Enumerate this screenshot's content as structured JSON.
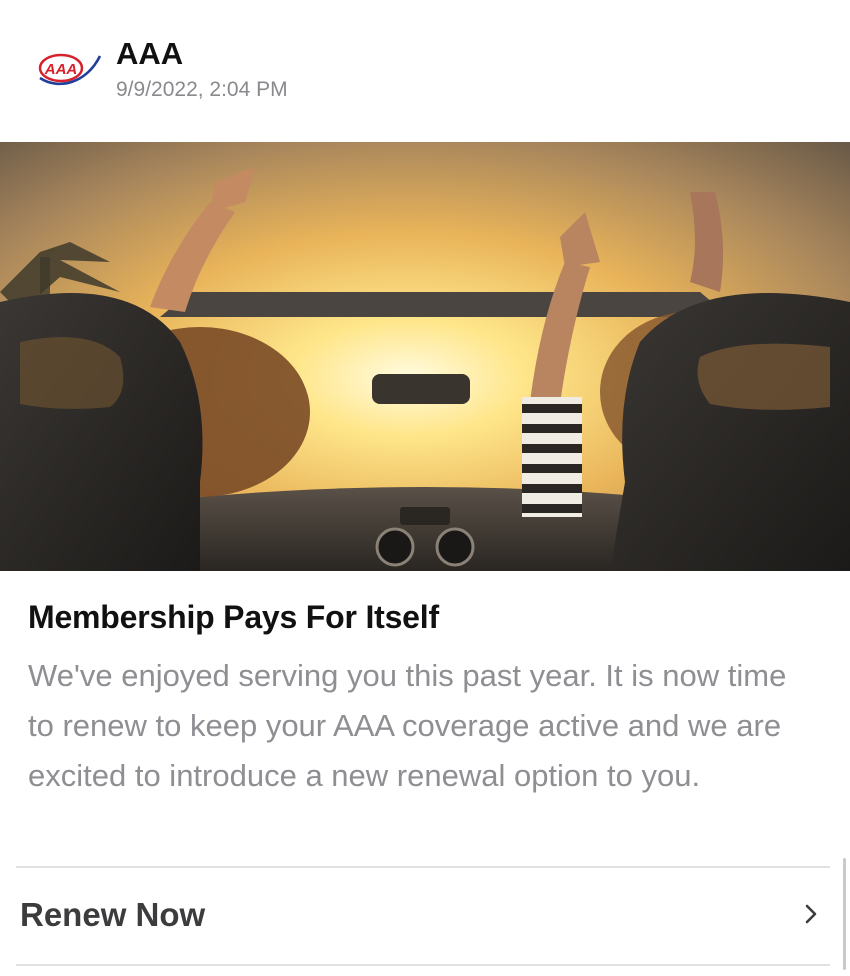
{
  "notification": {
    "sender": "AAA",
    "timestamp": "9/9/2022, 2:04 PM",
    "logo_icon": "aaa-logo-icon",
    "logo_text": "AAA"
  },
  "hero_image": {
    "subject": "two people in a convertible raising hands toward a sunset"
  },
  "message": {
    "title": "Membership Pays For Itself",
    "body": "We've enjoyed serving you this past year. It is now time to renew to keep your AAA coverage active and we are excited to introduce a new renewal option to you."
  },
  "action": {
    "label": "Renew Now",
    "icon": "chevron-right-icon"
  },
  "colors": {
    "logo_red": "#d6202b",
    "logo_blue": "#1f3f9a",
    "secondary_text": "#8e8e93",
    "divider": "#e2e2e4"
  }
}
